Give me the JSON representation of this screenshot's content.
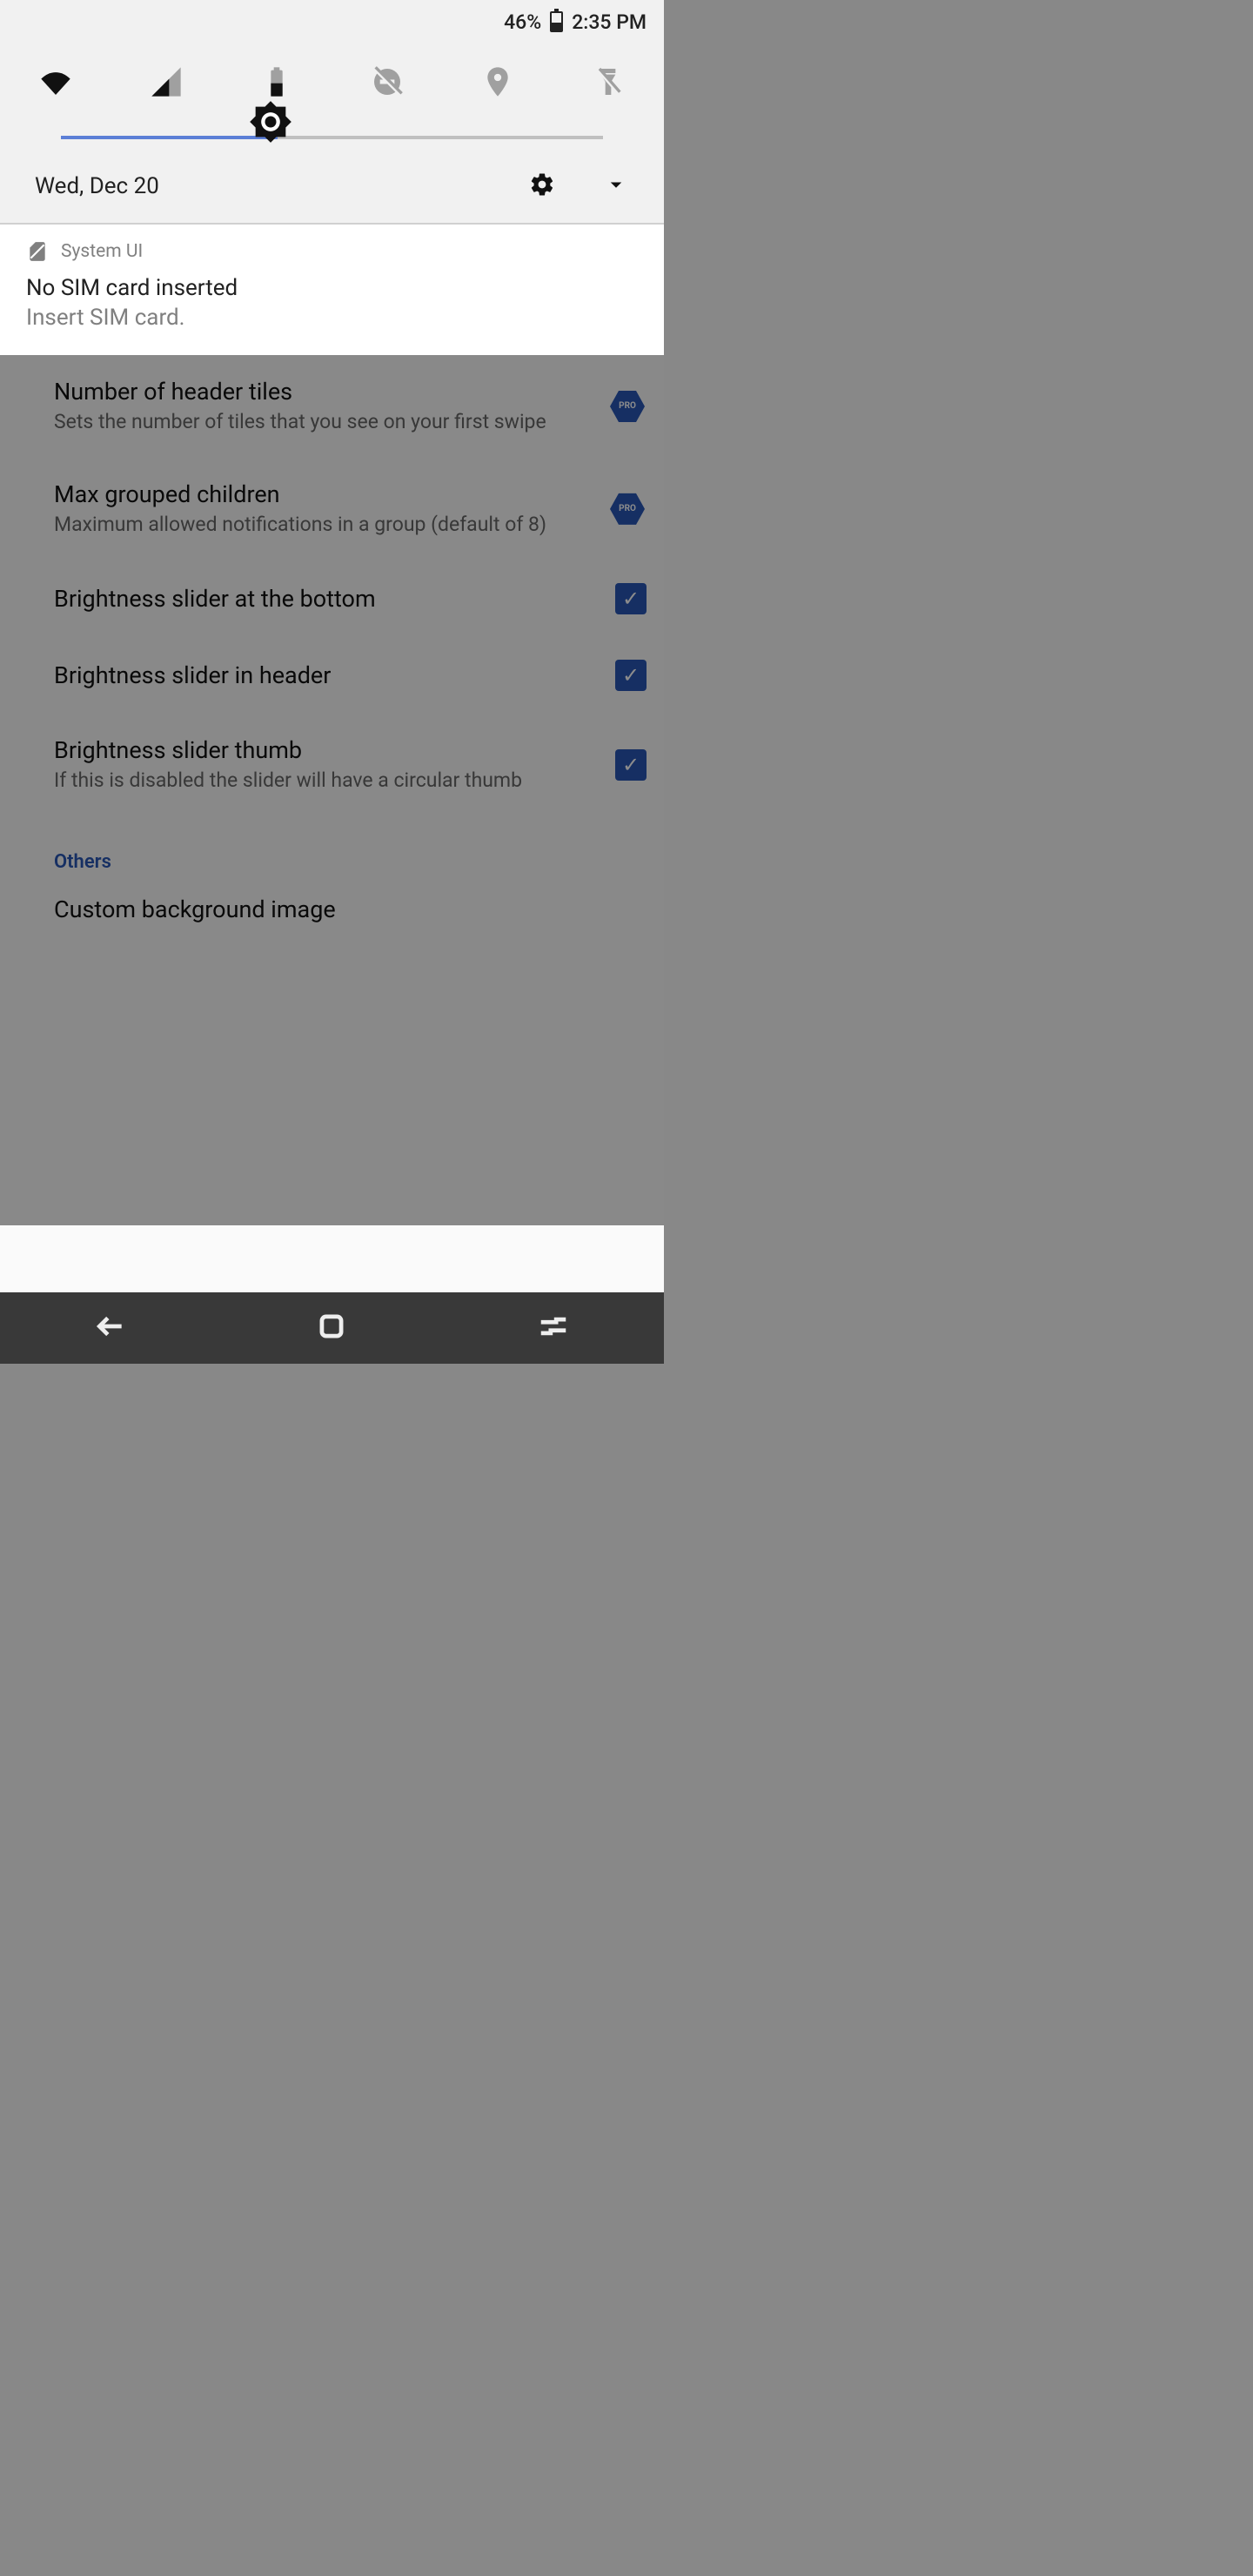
{
  "status": {
    "battery_pct": "46%",
    "time": "2:35 PM"
  },
  "qs": {
    "date": "Wed, Dec 20",
    "brightness_pct": 40,
    "tiles": [
      {
        "name": "wifi",
        "active": true
      },
      {
        "name": "cellular",
        "active": true
      },
      {
        "name": "battery-tile",
        "active": true
      },
      {
        "name": "do-not-disturb",
        "active": false
      },
      {
        "name": "location",
        "active": false
      },
      {
        "name": "flashlight",
        "active": false
      }
    ]
  },
  "notification": {
    "app": "System UI",
    "title": "No SIM card inserted",
    "text": "Insert SIM card."
  },
  "settings": {
    "rows": [
      {
        "title": "Number of header tiles",
        "sub": "Sets the number of tiles that you see on your first swipe",
        "type": "pro"
      },
      {
        "title": "Max grouped children",
        "sub": "Maximum allowed notifications in a group (default of 8)",
        "type": "pro"
      },
      {
        "title": "Brightness slider at the bottom",
        "sub": "",
        "type": "check"
      },
      {
        "title": "Brightness slider in header",
        "sub": "",
        "type": "check"
      },
      {
        "title": "Brightness slider thumb",
        "sub": "If this is disabled the slider will have a circular thumb",
        "type": "check"
      }
    ],
    "section_others": "Others",
    "row_custom_bg": "Custom background image",
    "pro_label": "PRO",
    "checkmark": "✓"
  }
}
